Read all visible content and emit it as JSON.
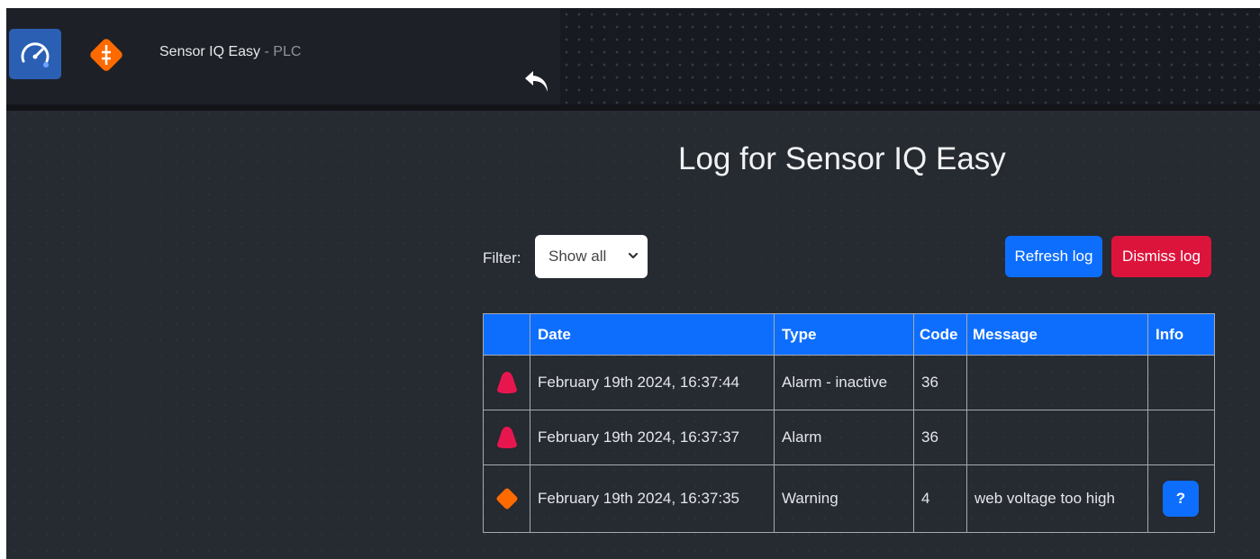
{
  "header": {
    "app_title": "Sensor IQ Easy",
    "app_subtitle": " - PLC",
    "icons": {
      "app": "speedometer-icon",
      "status": "warning-diamond-icon",
      "back": "back-arrow-icon"
    }
  },
  "main": {
    "page_title": "Log for Sensor IQ Easy",
    "filter": {
      "label": "Filter:",
      "selected": "Show all"
    },
    "buttons": {
      "refresh": "Refresh log",
      "dismiss": "Dismiss log"
    },
    "table": {
      "columns": [
        "",
        "Date",
        "Type",
        "Code",
        "Message",
        "Info"
      ],
      "rows": [
        {
          "severity": "alarm",
          "date": "February 19th 2024, 16:37:44",
          "type": "Alarm - inactive",
          "code": "36",
          "message": "",
          "info": ""
        },
        {
          "severity": "alarm",
          "date": "February 19th 2024, 16:37:37",
          "type": "Alarm",
          "code": "36",
          "message": "",
          "info": ""
        },
        {
          "severity": "warning",
          "date": "February 19th 2024, 16:37:35",
          "type": "Warning",
          "code": "4",
          "message": "web voltage too high",
          "info": "?"
        }
      ]
    }
  },
  "colors": {
    "background": "#262a31",
    "primary": "#0d6efd",
    "danger": "#dc143c",
    "alarm": "#e8164f",
    "warning": "#ff6a00"
  }
}
